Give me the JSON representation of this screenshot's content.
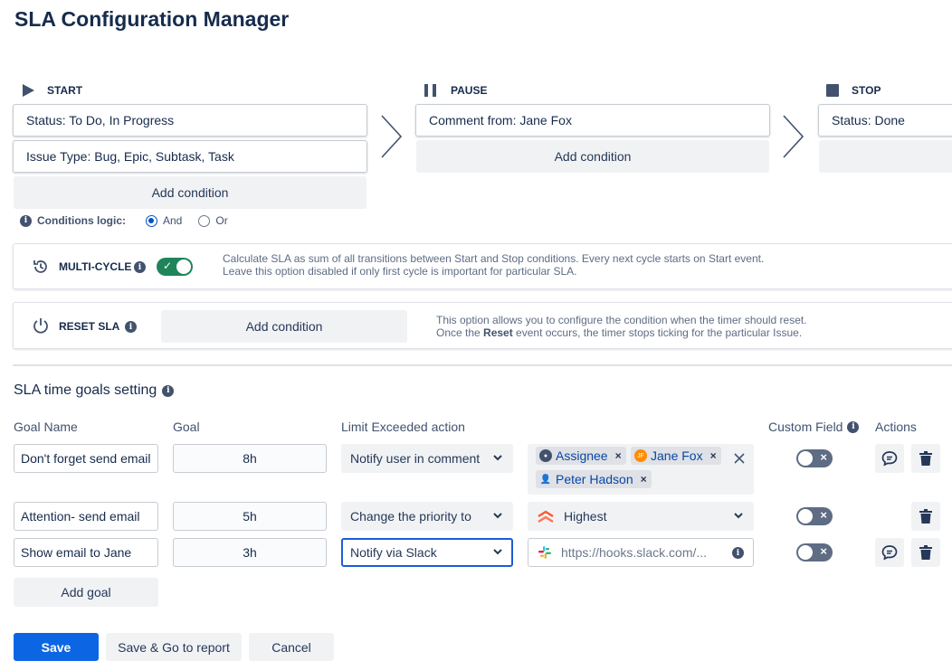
{
  "page": {
    "title": "SLA Configuration Manager"
  },
  "stages": {
    "start": {
      "label": "START",
      "conditions": [
        "Status: To Do, In Progress",
        "Issue Type: Bug, Epic, Subtask, Task"
      ],
      "add": "Add condition"
    },
    "pause": {
      "label": "PAUSE",
      "conditions": [
        "Comment from: Jane Fox"
      ],
      "add": "Add condition"
    },
    "stop": {
      "label": "STOP",
      "conditions": [
        "Status: Done"
      ]
    }
  },
  "logic": {
    "label": "Conditions logic:",
    "options": [
      "And",
      "Or"
    ],
    "selected": "And"
  },
  "multicycle": {
    "label": "MULTI-CYCLE",
    "enabled": true,
    "desc1": "Calculate SLA as sum of all transitions between Start and Stop conditions. Every next cycle starts on Start event.",
    "desc2": "Leave this option disabled if only first cycle is important for particular SLA."
  },
  "reset": {
    "label": "RESET SLA",
    "add": "Add condition",
    "desc1": "This option allows you to configure the condition when the timer should reset.",
    "desc2_pre": "Once the ",
    "desc2_bold": "Reset",
    "desc2_post": " event occurs, the timer stops ticking for the particular Issue."
  },
  "goals": {
    "title": "SLA time goals setting",
    "headers": {
      "name": "Goal Name",
      "goal": "Goal",
      "action": "Limit Exceeded action",
      "custom": "Custom Field",
      "actions": "Actions"
    },
    "rows": [
      {
        "name": "Don't forget send email",
        "goal": "8h",
        "action": "Notify user in comment",
        "recipients": [
          "Assignee",
          "Jane Fox",
          "Peter Hadson"
        ],
        "jf_initials": "JF",
        "custom_field": false
      },
      {
        "name": "Attention- send email",
        "goal": "5h",
        "action": "Change the priority to",
        "priority": "Highest",
        "custom_field": false
      },
      {
        "name": "Show email to Jane",
        "goal": "3h",
        "action": "Notify via Slack",
        "webhook_placeholder": "https://hooks.slack.com/...",
        "custom_field": false
      }
    ],
    "add_goal": "Add goal"
  },
  "footer": {
    "save": "Save",
    "save_report": "Save & Go to report",
    "cancel": "Cancel"
  },
  "colors": {
    "primary": "#0c66e4",
    "toggle_on": "#1f845a",
    "toggle_off": "#5e6c84",
    "jane_avatar": "#ff8b00",
    "priority_highest": "#ff5630"
  }
}
